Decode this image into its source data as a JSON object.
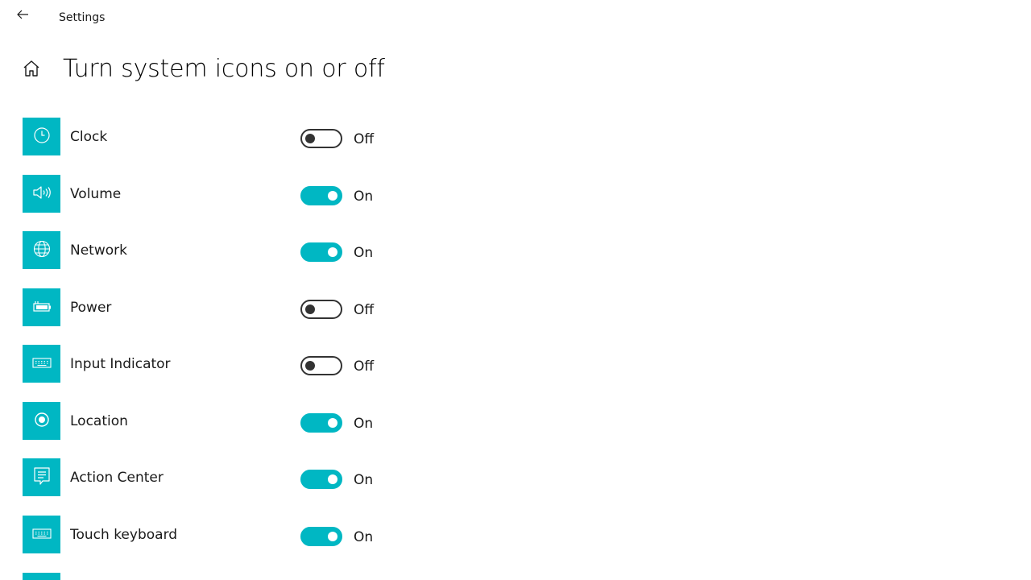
{
  "window": {
    "title": "Settings"
  },
  "page": {
    "title": "Turn system icons on or off"
  },
  "colors": {
    "accent": "#00b7c3",
    "toggle_off_border": "#333333",
    "background": "#ffffff"
  },
  "icons": {
    "back": "back-arrow-icon",
    "home": "home-icon"
  },
  "items": [
    {
      "label": "Clock",
      "icon": "clock-icon",
      "on": false,
      "state": "Off"
    },
    {
      "label": "Volume",
      "icon": "volume-icon",
      "on": true,
      "state": "On"
    },
    {
      "label": "Network",
      "icon": "globe-icon",
      "on": true,
      "state": "On"
    },
    {
      "label": "Power",
      "icon": "battery-icon",
      "on": false,
      "state": "Off"
    },
    {
      "label": "Input Indicator",
      "icon": "keyboard-icon",
      "on": false,
      "state": "Off"
    },
    {
      "label": "Location",
      "icon": "location-icon",
      "on": true,
      "state": "On"
    },
    {
      "label": "Action Center",
      "icon": "action-center-icon",
      "on": true,
      "state": "On"
    },
    {
      "label": "Touch keyboard",
      "icon": "touch-keyboard-icon",
      "on": true,
      "state": "On"
    }
  ]
}
